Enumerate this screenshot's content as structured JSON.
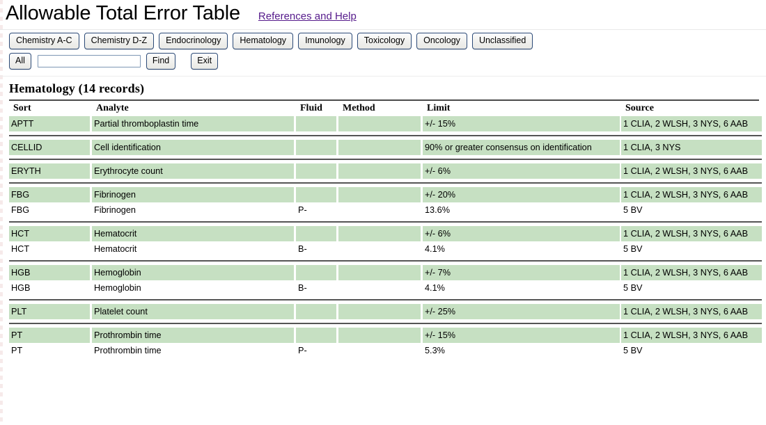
{
  "header": {
    "title": "Allowable Total Error Table",
    "help_link": "References and Help"
  },
  "toolbar": {
    "categories": [
      "Chemistry A-C",
      "Chemistry D-Z",
      "Endocrinology",
      "Hematology",
      "Imunology",
      "Toxicology",
      "Oncology",
      "Unclassified"
    ],
    "all_label": "All",
    "find_label": "Find",
    "exit_label": "Exit",
    "search_value": "",
    "search_placeholder": ""
  },
  "section": {
    "heading": "Hematology (14 records)"
  },
  "table": {
    "columns": [
      "Sort",
      "Analyte",
      "Fluid",
      "Method",
      "Limit",
      "Source"
    ],
    "groups": [
      {
        "rows": [
          {
            "shaded": true,
            "sort": "APTT",
            "analyte": "Partial thromboplastin time",
            "fluid": "",
            "method": "",
            "limit": "+/- 15%",
            "source": "1 CLIA, 2 WLSH, 3 NYS, 6 AAB"
          }
        ]
      },
      {
        "rows": [
          {
            "shaded": true,
            "sort": "CELLID",
            "analyte": "Cell identification",
            "fluid": "",
            "method": "",
            "limit": "90% or greater consensus on identification",
            "source": "1 CLIA, 3 NYS"
          }
        ]
      },
      {
        "rows": [
          {
            "shaded": true,
            "sort": "ERYTH",
            "analyte": "Erythrocyte count",
            "fluid": "",
            "method": "",
            "limit": "+/- 6%",
            "source": "1 CLIA, 2 WLSH, 3 NYS, 6 AAB"
          }
        ]
      },
      {
        "rows": [
          {
            "shaded": true,
            "sort": "FBG",
            "analyte": "Fibrinogen",
            "fluid": "",
            "method": "",
            "limit": "+/- 20%",
            "source": "1 CLIA, 2 WLSH, 3 NYS, 6 AAB"
          },
          {
            "shaded": false,
            "sort": "FBG",
            "analyte": "Fibrinogen",
            "fluid": "P-",
            "method": "",
            "limit": "13.6%",
            "source": "5 BV"
          }
        ]
      },
      {
        "rows": [
          {
            "shaded": true,
            "sort": "HCT",
            "analyte": "Hematocrit",
            "fluid": "",
            "method": "",
            "limit": "+/- 6%",
            "source": "1 CLIA, 2 WLSH, 3 NYS, 6 AAB"
          },
          {
            "shaded": false,
            "sort": "HCT",
            "analyte": "Hematocrit",
            "fluid": "B-",
            "method": "",
            "limit": "4.1%",
            "source": "5 BV"
          }
        ]
      },
      {
        "rows": [
          {
            "shaded": true,
            "sort": "HGB",
            "analyte": "Hemoglobin",
            "fluid": "",
            "method": "",
            "limit": "+/- 7%",
            "source": "1 CLIA, 2 WLSH, 3 NYS, 6 AAB"
          },
          {
            "shaded": false,
            "sort": "HGB",
            "analyte": "Hemoglobin",
            "fluid": "B-",
            "method": "",
            "limit": "4.1%",
            "source": "5 BV"
          }
        ]
      },
      {
        "rows": [
          {
            "shaded": true,
            "sort": "PLT",
            "analyte": "Platelet count",
            "fluid": "",
            "method": "",
            "limit": "+/- 25%",
            "source": "1 CLIA, 2 WLSH, 3 NYS, 6 AAB"
          }
        ]
      },
      {
        "rows": [
          {
            "shaded": true,
            "sort": "PT",
            "analyte": "Prothrombin time",
            "fluid": "",
            "method": "",
            "limit": "+/- 15%",
            "source": "1 CLIA, 2 WLSH, 3 NYS, 6 AAB"
          },
          {
            "shaded": false,
            "sort": "PT",
            "analyte": "Prothrombin time",
            "fluid": "P-",
            "method": "",
            "limit": "5.3%",
            "source": "5 BV"
          }
        ]
      }
    ]
  },
  "colors": {
    "row_shaded": "#c6e0c2",
    "link": "#551a8b",
    "button_border": "#2c4a77"
  }
}
